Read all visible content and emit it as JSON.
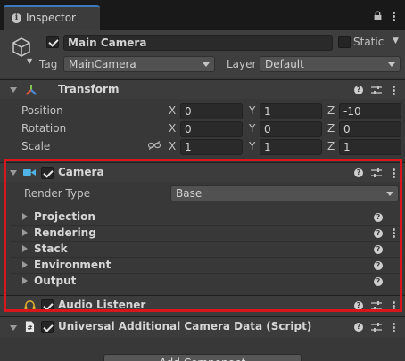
{
  "tab": {
    "label": "Inspector",
    "icon": "info-icon"
  },
  "gameobject": {
    "name": "Main Camera",
    "active": true,
    "static_label": "Static",
    "static_checked": false,
    "tag_label": "Tag",
    "tag_value": "MainCamera",
    "layer_label": "Layer",
    "layer_value": "Default"
  },
  "transform": {
    "title": "Transform",
    "axis_x": "X",
    "axis_y": "Y",
    "axis_z": "Z",
    "rows": [
      {
        "label": "Position",
        "x": "0",
        "y": "1",
        "z": "-10"
      },
      {
        "label": "Rotation",
        "x": "0",
        "y": "0",
        "z": "0"
      },
      {
        "label": "Scale",
        "x": "1",
        "y": "1",
        "z": "1"
      }
    ]
  },
  "camera": {
    "title": "Camera",
    "enabled": true,
    "render_type_label": "Render Type",
    "render_type_value": "Base",
    "sections": [
      "Projection",
      "Rendering",
      "Stack",
      "Environment",
      "Output"
    ]
  },
  "audio_listener": {
    "title": "Audio Listener",
    "enabled": true
  },
  "uacd": {
    "title": "Universal Additional Camera Data (Script)",
    "enabled": true
  },
  "add_component_label": "Add Component",
  "colors": {
    "highlight": "#d9161c",
    "accent": "#3a79bb",
    "camera_icon": "#4fb5e6"
  }
}
